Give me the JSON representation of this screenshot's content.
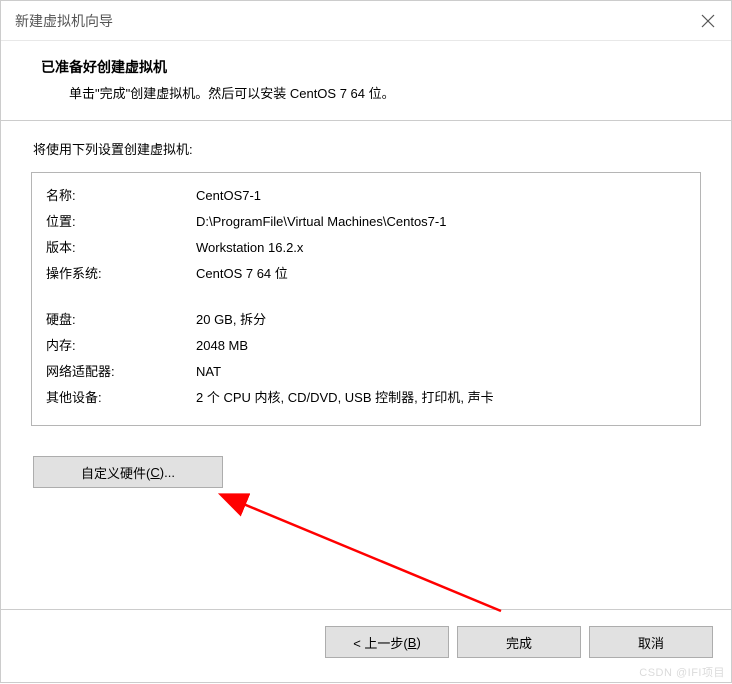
{
  "window": {
    "title": "新建虚拟机向导"
  },
  "header": {
    "title": "已准备好创建虚拟机",
    "subtitle": "单击\"完成\"创建虚拟机。然后可以安装 CentOS 7 64 位。"
  },
  "settings_intro": "将使用下列设置创建虚拟机:",
  "settings": {
    "name": {
      "label": "名称:",
      "value": "CentOS7-1"
    },
    "location": {
      "label": "位置:",
      "value": "D:\\ProgramFile\\Virtual Machines\\Centos7-1"
    },
    "version": {
      "label": "版本:",
      "value": "Workstation 16.2.x"
    },
    "os": {
      "label": "操作系统:",
      "value": "CentOS 7 64 位"
    },
    "disk": {
      "label": "硬盘:",
      "value": "20 GB, 拆分"
    },
    "memory": {
      "label": "内存:",
      "value": "2048 MB"
    },
    "network": {
      "label": "网络适配器:",
      "value": "NAT"
    },
    "other": {
      "label": "其他设备:",
      "value": "2 个 CPU 内核, CD/DVD, USB 控制器, 打印机, 声卡"
    }
  },
  "buttons": {
    "custom_hw_prefix": "自定义硬件(",
    "custom_hw_key": "C",
    "custom_hw_suffix": ")...",
    "back_prefix": "< 上一步(",
    "back_key": "B",
    "back_suffix": ")",
    "finish": "完成",
    "cancel": "取消"
  },
  "watermark": "CSDN @IFI项目"
}
